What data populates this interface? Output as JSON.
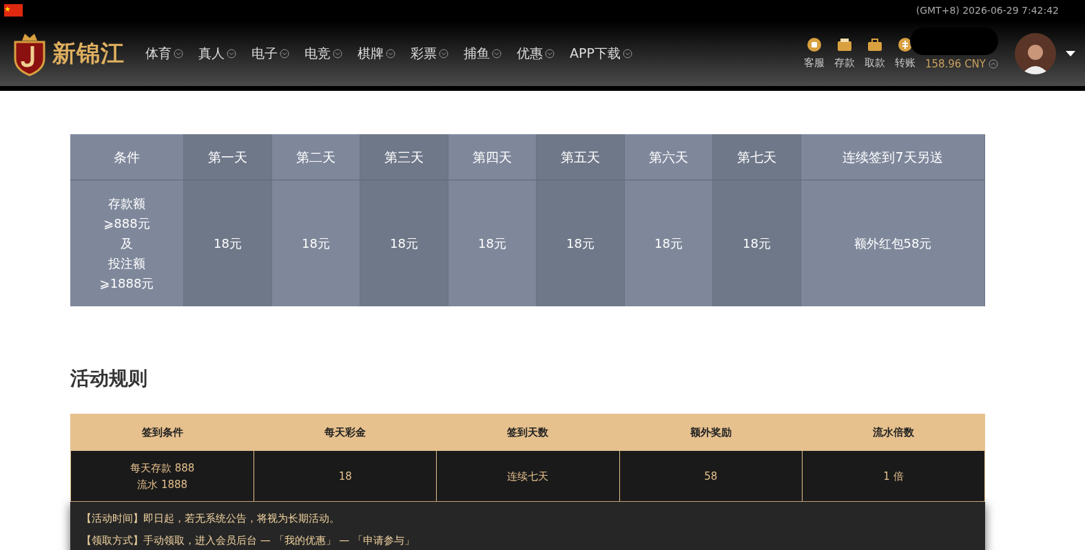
{
  "top_bar": {
    "clock": "(GMT+8) 2026-06-29 7:42:42"
  },
  "header": {
    "logo_text": "新锦江",
    "nav": [
      {
        "label": "体育"
      },
      {
        "label": "真人"
      },
      {
        "label": "电子"
      },
      {
        "label": "电竞"
      },
      {
        "label": "棋牌"
      },
      {
        "label": "彩票"
      },
      {
        "label": "捕鱼"
      },
      {
        "label": "优惠"
      },
      {
        "label": "APP下载"
      }
    ],
    "actions": [
      {
        "label": "客服",
        "kind": "chat"
      },
      {
        "label": "存款",
        "kind": "wallet"
      },
      {
        "label": "取款",
        "kind": "briefcase"
      },
      {
        "label": "转账",
        "kind": "coin"
      }
    ],
    "balance": "158.96 CNY"
  },
  "reward_table": {
    "columns": [
      "条件",
      "第一天",
      "第二天",
      "第三天",
      "第四天",
      "第五天",
      "第六天",
      "第七天",
      "连续签到7天另送"
    ],
    "row": [
      [
        "存款额",
        "⩾888元",
        "及",
        "投注额",
        "⩾1888元"
      ],
      "18元",
      "18元",
      "18元",
      "18元",
      "18元",
      "18元",
      "18元",
      "额外红包58元"
    ]
  },
  "rules": {
    "title": "活动规则",
    "columns": [
      "签到条件",
      "每天彩金",
      "签到天数",
      "额外奖励",
      "流水倍数"
    ],
    "row": [
      "每天存款 888\n流水 1888",
      "18",
      "连续七天",
      "58",
      "1 倍"
    ],
    "notes": [
      "【活动时间】即日起，若无系统公告，将视为长期活动。",
      "【领取方式】手动领取，进入会员后台 — 「我的优惠」 — 「申请参与」"
    ]
  }
}
